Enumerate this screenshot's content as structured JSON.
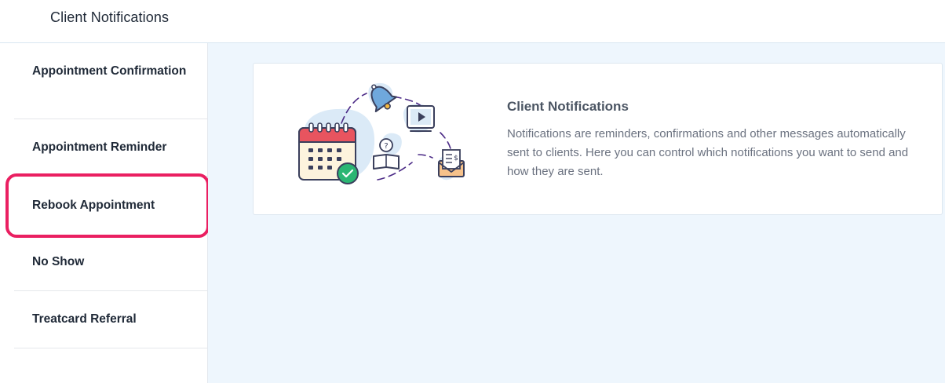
{
  "header": {
    "title": "Client Notifications"
  },
  "sidebar": {
    "items": [
      {
        "label": "Appointment Confirmation"
      },
      {
        "label": "Appointment Reminder"
      },
      {
        "label": "Rebook Appointment"
      },
      {
        "label": "No Show"
      },
      {
        "label": "Treatcard Referral"
      }
    ],
    "selected": "Rebook Appointment"
  },
  "card": {
    "title": "Client Notifications",
    "description": "Notifications are reminders, confirmations and other messages automatically sent to clients. Here you can control which notifications you want to send and how they are sent.",
    "illustration_icons": [
      "calendar-icon",
      "check-icon",
      "bell-icon",
      "video-icon",
      "book-icon",
      "envelope-icon"
    ]
  },
  "colors": {
    "highlight": "#ea1f61",
    "main_bg": "#eef6fd",
    "accent_purple": "#4b2a86",
    "calendar_red": "#e8545f",
    "check_green": "#2bb673"
  }
}
